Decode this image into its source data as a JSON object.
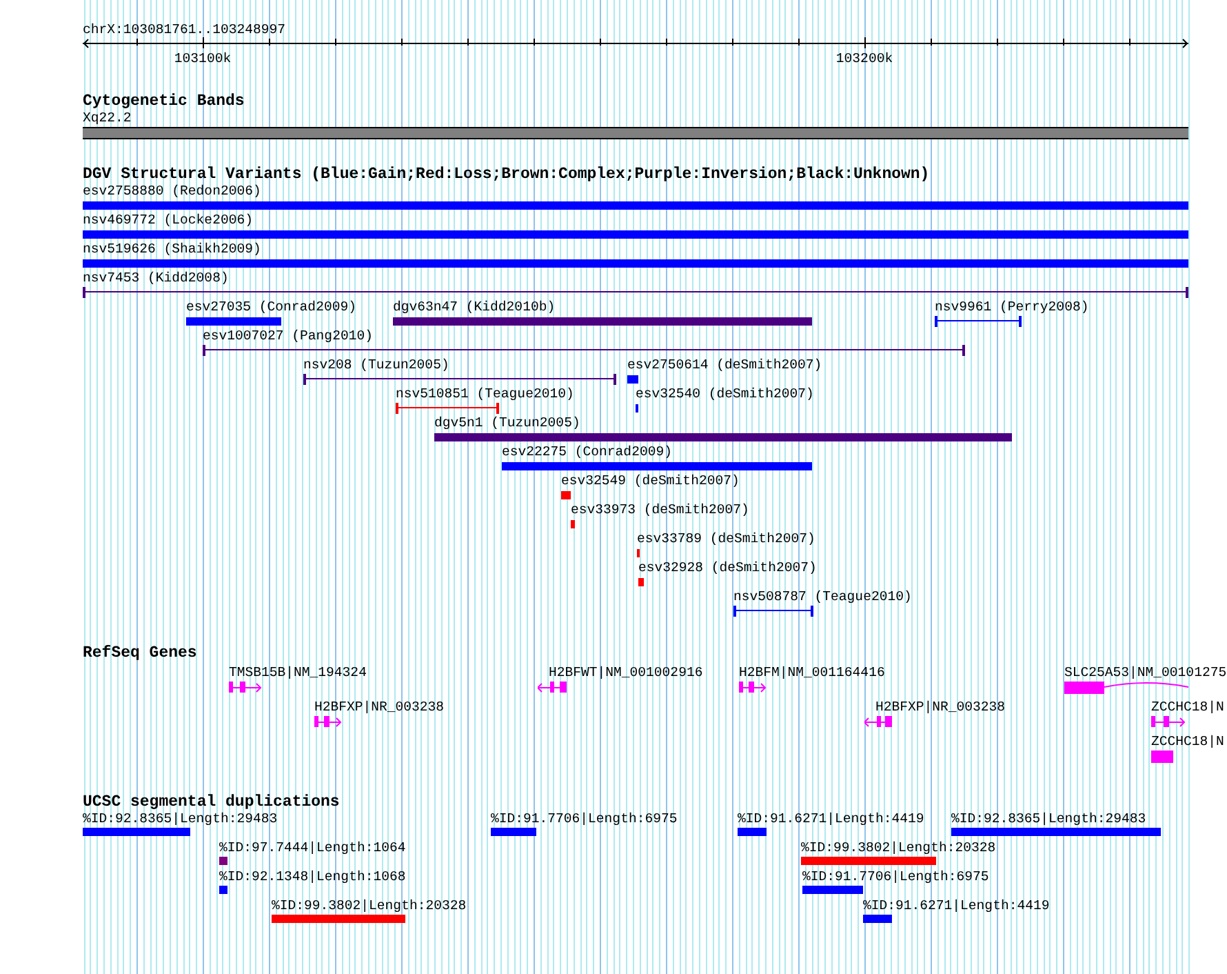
{
  "ruler": {
    "label": "chrX:103081761..103248997",
    "ticks": [
      {
        "label": "103100k"
      },
      {
        "label": "103200k"
      }
    ]
  },
  "tracks": [
    {
      "kind": "bands",
      "title": "Cytogenetic Bands",
      "bands": [
        {
          "label": "Xq22.2"
        }
      ]
    },
    {
      "kind": "variants",
      "title": "DGV Structural Variants (Blue:Gain;Red:Loss;Brown:Complex;Purple:Inversion;Black:Unknown)",
      "lanes": [
        [
          {
            "kind": "bar",
            "label": "esv2758880 (Redon2006)",
            "color": "#0000ff"
          }
        ],
        [
          {
            "kind": "bar",
            "label": "nsv469772 (Locke2006)",
            "color": "#0000ff"
          }
        ],
        [
          {
            "kind": "bar",
            "label": "nsv519626 (Shaikh2009)",
            "color": "#0000ff"
          }
        ],
        [
          {
            "kind": "span",
            "label": "nsv7453 (Kidd2008)",
            "color": "#4b0082"
          }
        ],
        [
          {
            "kind": "bar",
            "label": "esv27035 (Conrad2009)",
            "color": "#0000ff"
          },
          {
            "kind": "bar",
            "label": "dgv63n47 (Kidd2010b)",
            "color": "#4b0082"
          },
          {
            "kind": "span",
            "label": "nsv9961 (Perry2008)",
            "color": "#0000ff"
          }
        ],
        [
          {
            "kind": "span",
            "label": "esv1007027 (Pang2010)",
            "color": "#4b0082"
          }
        ],
        [
          {
            "kind": "span",
            "label": "nsv208 (Tuzun2005)",
            "color": "#4b0082"
          },
          {
            "kind": "bar",
            "label": "esv2750614 (deSmith2007)",
            "color": "#0000ff"
          }
        ],
        [
          {
            "kind": "span",
            "label": "nsv510851 (Teague2010)",
            "color": "#ff0000"
          },
          {
            "kind": "bar",
            "label": "esv32540 (deSmith2007)",
            "color": "#0000ff"
          }
        ],
        [
          {
            "kind": "bar",
            "label": "dgv5n1 (Tuzun2005)",
            "color": "#4b0082"
          }
        ],
        [
          {
            "kind": "bar",
            "label": "esv22275 (Conrad2009)",
            "color": "#0000ff"
          }
        ],
        [
          {
            "kind": "bar",
            "label": "esv32549 (deSmith2007)",
            "color": "#ff0000"
          }
        ],
        [
          {
            "kind": "bar",
            "label": "esv33973 (deSmith2007)",
            "color": "#ff0000"
          }
        ],
        [
          {
            "kind": "bar",
            "label": "esv33789 (deSmith2007)",
            "color": "#ff0000"
          }
        ],
        [
          {
            "kind": "bar",
            "label": "esv32928 (deSmith2007)",
            "color": "#ff0000"
          }
        ],
        [
          {
            "kind": "span",
            "label": "nsv508787 (Teague2010)",
            "color": "#0000ff"
          }
        ]
      ]
    },
    {
      "kind": "genes",
      "title": "RefSeq Genes",
      "lanes": [
        [
          {
            "label": "TMSB15B|NM_194324",
            "kind": "forward"
          },
          {
            "label": "H2BFWT|NM_001002916",
            "kind": "reverse"
          },
          {
            "label": "H2BFM|NM_001164416",
            "kind": "forward"
          },
          {
            "label": "SLC25A53|NM_00101275",
            "kind": "block"
          }
        ],
        [
          {
            "label": "H2BFXP|NR_003238",
            "kind": "forward"
          },
          {
            "label": "H2BFXP|NR_003238",
            "kind": "reverse"
          },
          {
            "label": "ZCCHC18|N",
            "kind": "forward"
          }
        ],
        [
          {
            "label": "ZCCHC18|N",
            "kind": "block"
          }
        ]
      ]
    },
    {
      "kind": "dups",
      "title": "UCSC segmental duplications",
      "lanes": [
        [
          {
            "kind": "bar",
            "label": "%ID:92.8365|Length:29483",
            "color": "#0000ff"
          },
          {
            "kind": "bar",
            "label": "%ID:91.7706|Length:6975",
            "color": "#0000ff"
          },
          {
            "kind": "bar",
            "label": "%ID:91.6271|Length:4419",
            "color": "#0000ff"
          },
          {
            "kind": "bar",
            "label": "%ID:92.8365|Length:29483",
            "color": "#0000ff"
          }
        ],
        [
          {
            "kind": "bar",
            "label": "%ID:97.7444|Length:1064",
            "color": "#800080"
          },
          {
            "kind": "bar",
            "label": "%ID:99.3802|Length:20328",
            "color": "#ff0000"
          }
        ],
        [
          {
            "kind": "bar",
            "label": "%ID:92.1348|Length:1068",
            "color": "#0000ff"
          },
          {
            "kind": "bar",
            "label": "%ID:91.7706|Length:6975",
            "color": "#0000ff"
          }
        ],
        [
          {
            "kind": "bar",
            "label": "%ID:99.3802|Length:20328",
            "color": "#ff0000"
          },
          {
            "kind": "bar",
            "label": "%ID:91.6271|Length:4419",
            "color": "#0000ff"
          }
        ]
      ]
    }
  ]
}
